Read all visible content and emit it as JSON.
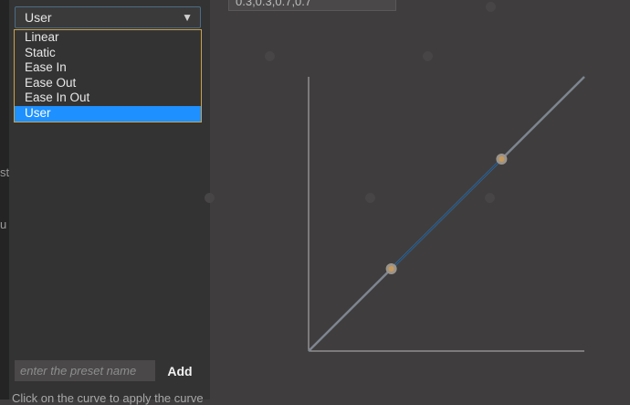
{
  "dropdown": {
    "selected": "User",
    "options": [
      "Linear",
      "Static",
      "Ease In",
      "Ease Out",
      "Ease In Out",
      "User"
    ]
  },
  "preset": {
    "placeholder": "enter the preset name",
    "add_label": "Add"
  },
  "hint": "Click on the curve to apply the curve",
  "curve": {
    "value_text": "0.3,0.3,0.7,0.7",
    "control_points": [
      [
        0.3,
        0.3
      ],
      [
        0.7,
        0.7
      ]
    ],
    "colors": {
      "axis": "#b8b8b8",
      "curve": "#7d8590",
      "bezier": "#1f4e7a",
      "handle": "#9a948c",
      "handle_center": "#c89a5a"
    }
  },
  "left_strip": {
    "fragments": [
      "st",
      "u"
    ]
  }
}
